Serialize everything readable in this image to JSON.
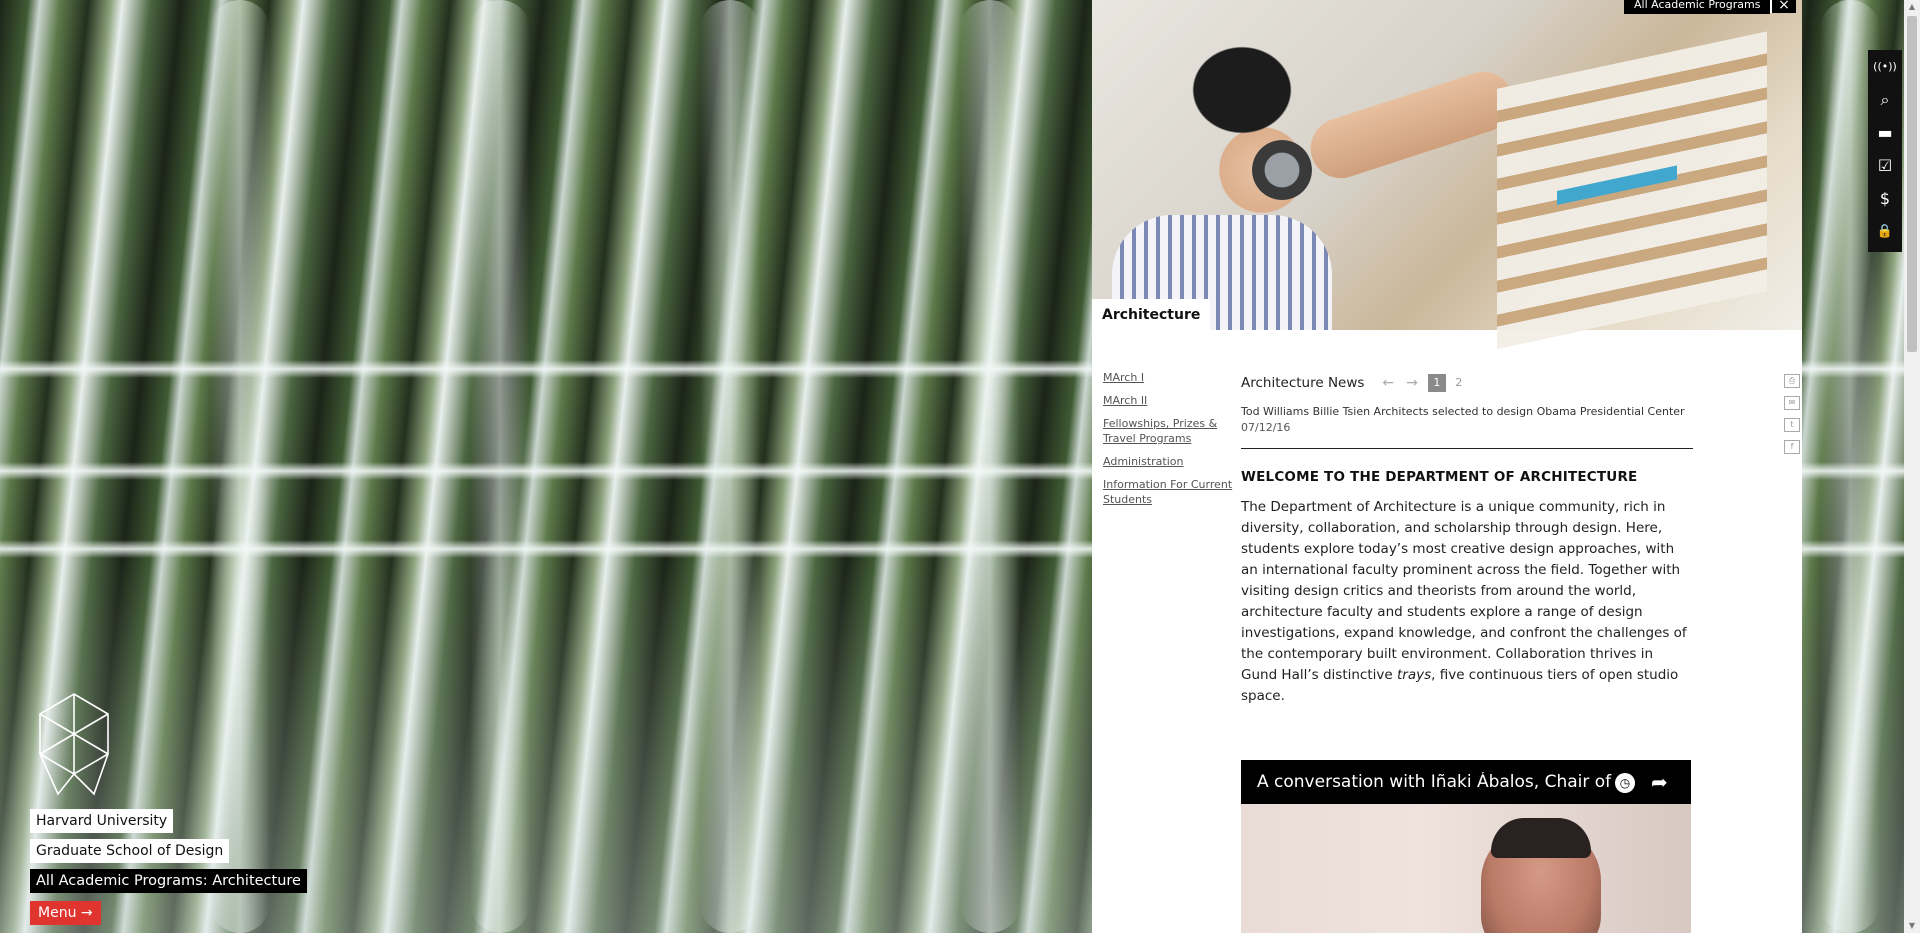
{
  "branding": {
    "university": "Harvard University",
    "school": "Graduate School of Design",
    "program_breadcrumb": "All Academic Programs: Architecture",
    "menu_label": "Menu →"
  },
  "panel": {
    "top_chip": "All Academic Programs",
    "close_icon": "×",
    "section_label": "Architecture",
    "subnav": [
      {
        "label": "MArch I"
      },
      {
        "label": "MArch II"
      },
      {
        "label": "Fellowships, Prizes & Travel Programs"
      },
      {
        "label": "Administration"
      },
      {
        "label": "Information For Current Students"
      }
    ],
    "news": {
      "title": "Architecture News",
      "prev_arrow": "←",
      "next_arrow": "→",
      "pages": [
        "1",
        "2"
      ],
      "active_page": "1",
      "item_title": "Tod Williams Billie Tsien Architects selected to design Obama Presidential Center",
      "item_date": "07/12/16"
    },
    "welcome": {
      "heading": "WELCOME TO THE DEPARTMENT OF ARCHITECTURE",
      "body_before_em": "The Department of Architecture is a unique community, rich in diversity, collaboration, and scholarship through design. Here, students explore today’s most creative design approaches, with an international faculty prominent across the field. Together with visiting design critics and theorists from around the world, architecture faculty and students explore a range of design investigations, expand knowledge, and confront the challenges of the contemporary built environment.  Collaboration thrives in Gund Hall’s distinctive ",
      "body_em": "trays",
      "body_after_em": ", five continuous tiers of open studio space."
    },
    "video": {
      "title": "A conversation with Iñaki Ábalos, Chair of t...",
      "clock_icon": "◷",
      "share_icon": "➦"
    },
    "tools": [
      {
        "icon": "print-icon",
        "glyph": "⎙"
      },
      {
        "icon": "email-icon",
        "glyph": "✉"
      },
      {
        "icon": "twitter-icon",
        "glyph": "t"
      },
      {
        "icon": "facebook-icon",
        "glyph": "f"
      }
    ]
  },
  "utilbar": [
    {
      "icon": "broadcast-icon",
      "glyph": "((•))"
    },
    {
      "icon": "search-icon",
      "glyph": "⌕"
    },
    {
      "icon": "chat-icon",
      "glyph": "▬"
    },
    {
      "icon": "checkbox-icon",
      "glyph": "☑"
    },
    {
      "icon": "donate-hand-icon",
      "glyph": "$"
    },
    {
      "icon": "lock-icon",
      "glyph": "🔒"
    }
  ],
  "colors": {
    "menu_red": "#e0342f",
    "panel_white": "#ffffff",
    "utilbar_black": "#111111"
  }
}
